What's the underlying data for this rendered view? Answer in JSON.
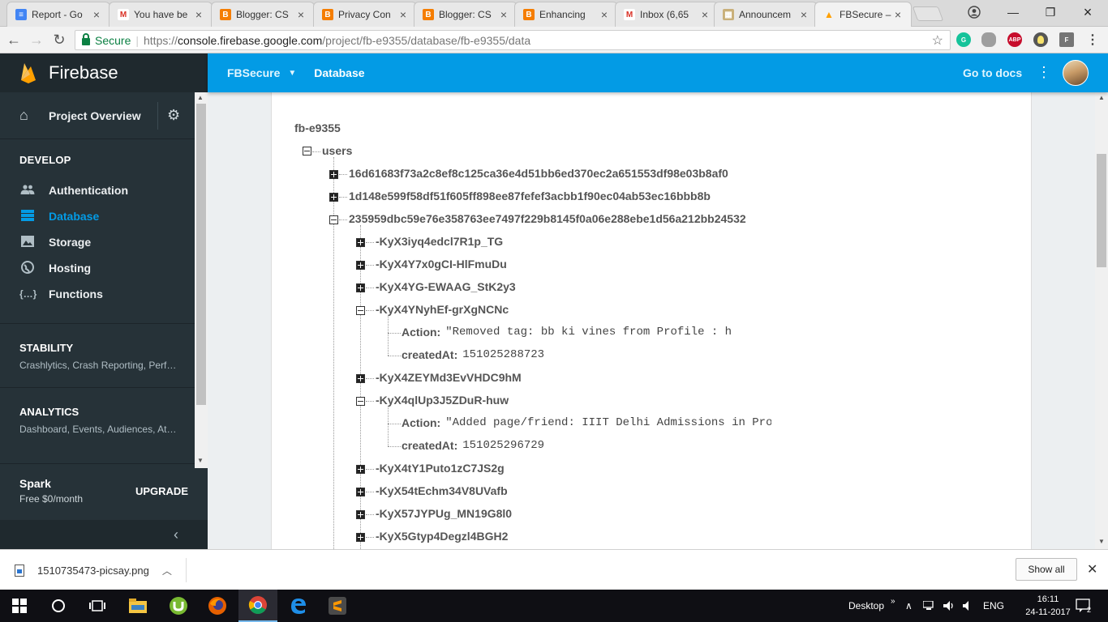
{
  "browser": {
    "tabs": [
      {
        "title": "Report - Go",
        "icon": "google-docs-icon",
        "color": "#4285f4",
        "glyph": "≡"
      },
      {
        "title": "You have be",
        "icon": "gmail-icon",
        "color": "#d93025",
        "glyph": "M"
      },
      {
        "title": "Blogger: CS",
        "icon": "blogger-icon",
        "color": "#f57d00",
        "glyph": "B"
      },
      {
        "title": "Privacy Con",
        "icon": "blogger-icon",
        "color": "#f57d00",
        "glyph": "B"
      },
      {
        "title": "Blogger: CS",
        "icon": "blogger-icon",
        "color": "#f57d00",
        "glyph": "B"
      },
      {
        "title": "Enhancing",
        "icon": "blogger-icon",
        "color": "#f57d00",
        "glyph": "B"
      },
      {
        "title": "Inbox (6,65",
        "icon": "gmail-icon",
        "color": "#d93025",
        "glyph": "M"
      },
      {
        "title": "Announcem",
        "icon": "announcement-icon",
        "color": "#c9b07a",
        "glyph": "▦"
      },
      {
        "title": "FBSecure –",
        "icon": "firebase-icon",
        "color": "#ffa000",
        "glyph": "▲",
        "active": true
      }
    ],
    "secure_label": "Secure",
    "url_scheme": "https://",
    "url_host": "console.firebase.google.com",
    "url_path": "/project/fb-e9355/database/fb-e9355/data",
    "extensions": [
      {
        "name": "grammarly-extension-icon",
        "label": "G",
        "color": "#15c39a"
      },
      {
        "name": "cloud-extension-icon",
        "label": "",
        "color": "#9e9e9e"
      },
      {
        "name": "adblock-plus-extension-icon",
        "label": "ABP",
        "color": "#c70d2c"
      },
      {
        "name": "bulb-extension-icon",
        "label": "",
        "color": "#555555"
      },
      {
        "name": "f-extension-icon",
        "label": "F",
        "color": "#757575"
      }
    ]
  },
  "firebase": {
    "brand": "Firebase",
    "project_overview": "Project Overview",
    "develop_title": "DEVELOP",
    "develop_items": [
      {
        "label": "Authentication",
        "icon": "people-icon",
        "glyph": "👥"
      },
      {
        "label": "Database",
        "icon": "database-icon",
        "glyph": "☰",
        "active": true
      },
      {
        "label": "Storage",
        "icon": "image-icon",
        "glyph": "▣"
      },
      {
        "label": "Hosting",
        "icon": "globe-icon",
        "glyph": "◍"
      },
      {
        "label": "Functions",
        "icon": "functions-icon",
        "glyph": "{…}"
      }
    ],
    "stability_title": "STABILITY",
    "stability_sub": "Crashlytics, Crash Reporting, Perf…",
    "analytics_title": "ANALYTICS",
    "analytics_sub": "Dashboard, Events, Audiences, At…",
    "plan_name": "Spark",
    "plan_price": "Free $0/month",
    "upgrade": "UPGRADE",
    "header_project": "FBSecure",
    "header_section": "Database",
    "go_to_docs": "Go to docs"
  },
  "database": {
    "root": "fb-e9355",
    "users_key": "users",
    "user_ids": [
      "16d61683f73a2c8ef8c125ca36e4d51bb6ed370ec2a651553df98e03b8af0",
      "1d148e599f58df51f605ff898ee87fefef3acbb1f90ec04ab53ec16bbb8b",
      "235959dbc59e76e358763ee7497f229b8145f0a06e288ebe1d56a212bb24532"
    ],
    "records": [
      {
        "key": "-KyX3iyq4edcl7R1p_TG"
      },
      {
        "key": "-KyX4Y7x0gCI-HlFmuDu"
      },
      {
        "key": "-KyX4YG-EWAAG_StK2y3"
      },
      {
        "key": "-KyX4YNyhEf-grXgNCNc",
        "expanded": true,
        "action_label": "Action:",
        "action_value": "\"Removed tag: bb ki vines from Profile : h",
        "created_label": "createdAt:",
        "created_value": "151025288723"
      },
      {
        "key": "-KyX4ZEYMd3EvVHDC9hM"
      },
      {
        "key": "-KyX4qlUp3J5ZDuR-huw",
        "expanded": true,
        "action_label": "Action:",
        "action_value": "\"Added page/friend: IIIT Delhi Admissions in Pro",
        "created_label": "createdAt:",
        "created_value": "151025296729"
      },
      {
        "key": "-KyX4tY1Puto1zC7JS2g"
      },
      {
        "key": "-KyX54tEchm34V8UVafb"
      },
      {
        "key": "-KyX57JYPUg_MN19G8l0"
      },
      {
        "key": "-KyX5Gtyp4Degzl4BGH2"
      }
    ]
  },
  "downloads": {
    "file": "1510735473-picsay.png",
    "show_all": "Show all"
  },
  "taskbar": {
    "desktop_label": "Desktop",
    "language": "ENG",
    "time": "16:11",
    "date": "24-11-2017",
    "notifications": "2"
  }
}
